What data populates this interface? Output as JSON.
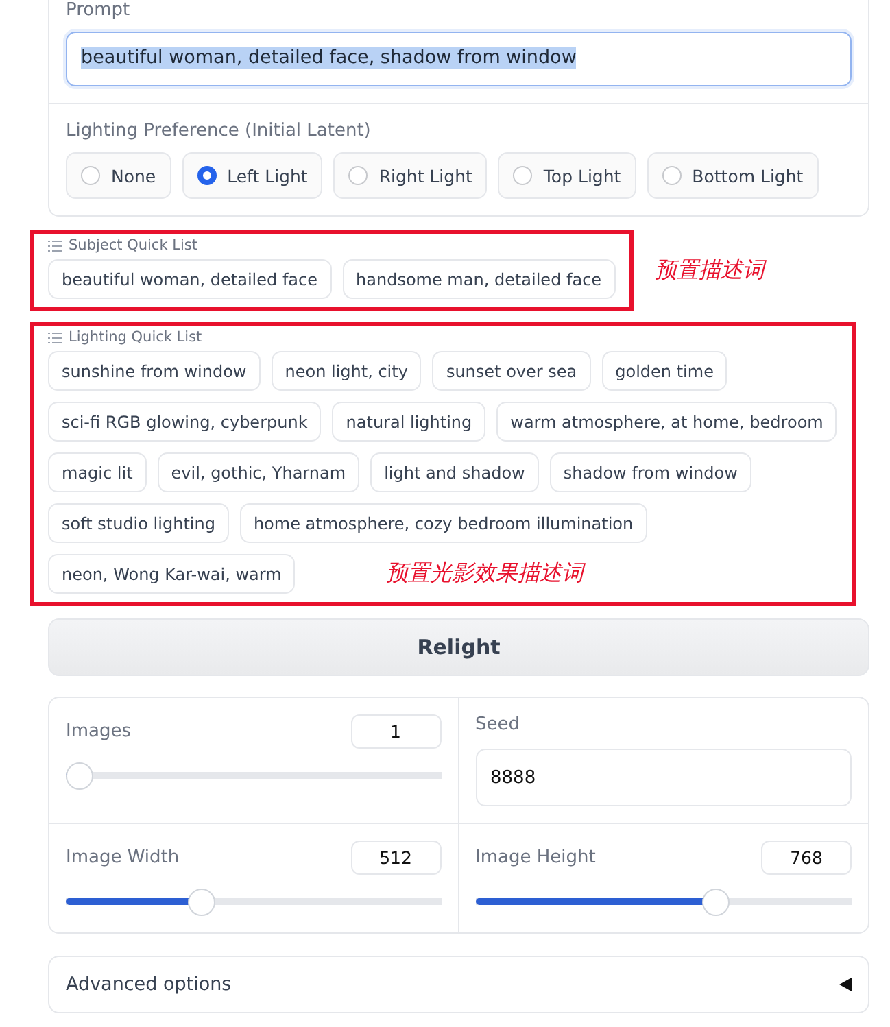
{
  "prompt": {
    "label": "Prompt",
    "value": "beautiful woman, detailed face, shadow from window",
    "text_selected": true
  },
  "lighting_preference": {
    "label": "Lighting Preference (Initial Latent)",
    "options": [
      {
        "label": "None",
        "selected": false
      },
      {
        "label": "Left Light",
        "selected": true
      },
      {
        "label": "Right Light",
        "selected": false
      },
      {
        "label": "Top Light",
        "selected": false
      },
      {
        "label": "Bottom Light",
        "selected": false
      }
    ]
  },
  "subject_quick_list": {
    "title": "Subject Quick List",
    "rows": [
      [
        "beautiful woman, detailed face",
        "handsome man, detailed face"
      ]
    ],
    "annotation": "预置描述词"
  },
  "lighting_quick_list": {
    "title": "Lighting Quick List",
    "rows": [
      [
        "sunshine from window",
        "neon light, city",
        "sunset over sea",
        "golden time"
      ],
      [
        "sci-fi RGB glowing, cyberpunk",
        "natural lighting",
        "warm atmosphere, at home, bedroom"
      ],
      [
        "magic lit",
        "evil, gothic, Yharnam",
        "light and shadow",
        "shadow from window"
      ],
      [
        "soft studio lighting",
        "home atmosphere, cozy bedroom illumination"
      ],
      [
        "neon, Wong Kar-wai, warm"
      ]
    ],
    "annotation": "预置光影效果描述词"
  },
  "relight_button": "Relight",
  "settings": [
    {
      "kind": "slider",
      "label": "Images",
      "value": "1",
      "level": 0
    },
    {
      "kind": "number",
      "label": "Seed",
      "value": "8888"
    },
    {
      "kind": "slider",
      "label": "Image Width",
      "value": "512",
      "level": 0.35
    },
    {
      "kind": "slider",
      "label": "Image Height",
      "value": "768",
      "level": 0.65
    }
  ],
  "advanced_options": {
    "label": "Advanced options",
    "expanded": false
  }
}
